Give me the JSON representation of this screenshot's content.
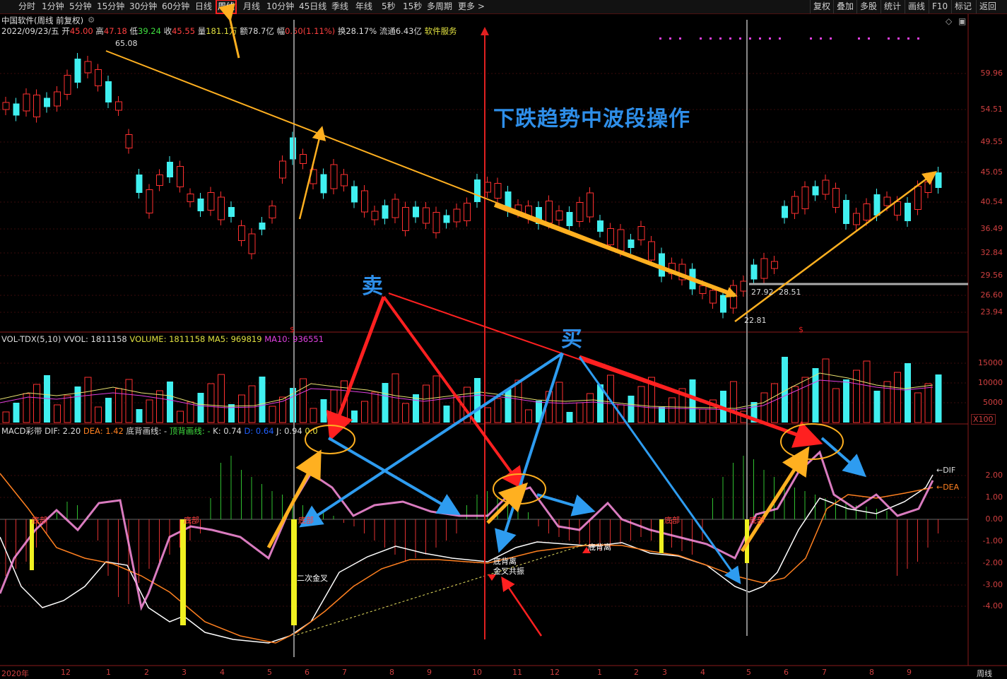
{
  "toolbar": {
    "tabs": [
      "分时",
      "1分钟",
      "5分钟",
      "15分钟",
      "30分钟",
      "60分钟",
      "日线",
      "周线",
      "月线",
      "10分钟",
      "45日线",
      "季线",
      "年线",
      "5秒",
      "15秒",
      "多周期",
      "更多 >"
    ],
    "active_tab": "周线",
    "right_buttons": [
      "复权",
      "叠加",
      "多股",
      "统计",
      "画线",
      "F10",
      "标记",
      "返回"
    ]
  },
  "stock": {
    "title": "中国软件(周线 前复权)",
    "date": "2022/09/23/五",
    "open_label": "开",
    "open": "45.00",
    "high_label": "高",
    "high": "47.18",
    "low_label": "低",
    "low": "39.24",
    "close_label": "收",
    "close": "45.55",
    "vol_label": "量",
    "vol": "181.1万",
    "amount_label": "额",
    "amount": "78.7亿",
    "chg_label": "幅",
    "chg": "0.50(1.11%)",
    "turnover": "换28.17%",
    "float": "流通6.43亿",
    "sector": "软件服务"
  },
  "price_axis": [
    "59.96",
    "54.51",
    "49.55",
    "45.05",
    "40.54",
    "36.49",
    "32.84",
    "29.56",
    "26.60",
    "23.94"
  ],
  "price_marks": {
    "high": "65.08",
    "low": "22.81",
    "mark1": "27.92",
    "mark2": "28.51"
  },
  "vol_panel": {
    "name": "VOL-TDX(5,10)",
    "vvol": "VVOL: 1811158",
    "volume": "VOLUME: 1811158",
    "ma5": "MA5: 969819",
    "ma10": "MA10: 936551",
    "axis": [
      "15000",
      "10000",
      "5000"
    ],
    "unit": "X100"
  },
  "macd_panel": {
    "name": "MACD彩带",
    "dif": "DIF: 2.20",
    "dea": "DEA: 1.42",
    "bottom_line": "底背画线: -",
    "top_line": "顶背画线: -",
    "k": "K: 0.74",
    "d": "D: 0.64",
    "j": "J: 0.94",
    "extra": "0.0",
    "axis": [
      "2.00",
      "1.00",
      "0.00",
      "-1.00",
      "-2.00",
      "-3.00",
      "-4.00"
    ],
    "dif_tag": "←DIF",
    "dea_tag": "←DEA"
  },
  "annotations": {
    "headline": "下跌趋势中波段操作",
    "sell": "卖",
    "buy": "买",
    "bottom1": "底部",
    "second_cross": "二次金叉",
    "bottom_divergence": "底背离",
    "golden_resonance": "金叉共振",
    "bottom_divergence2": "底背离"
  },
  "x_axis": [
    "2020年",
    "12",
    "1",
    "2",
    "3",
    "4",
    "5",
    "6",
    "7",
    "8",
    "9",
    "10",
    "11",
    "12",
    "1",
    "2",
    "3",
    "4",
    "5",
    "6",
    "7",
    "8",
    "9"
  ],
  "period_label": "周线",
  "colors": {
    "up": "#ff3030",
    "down": "#40f0f0",
    "accent": "#ffb020",
    "blue": "#2e9cf0"
  }
}
